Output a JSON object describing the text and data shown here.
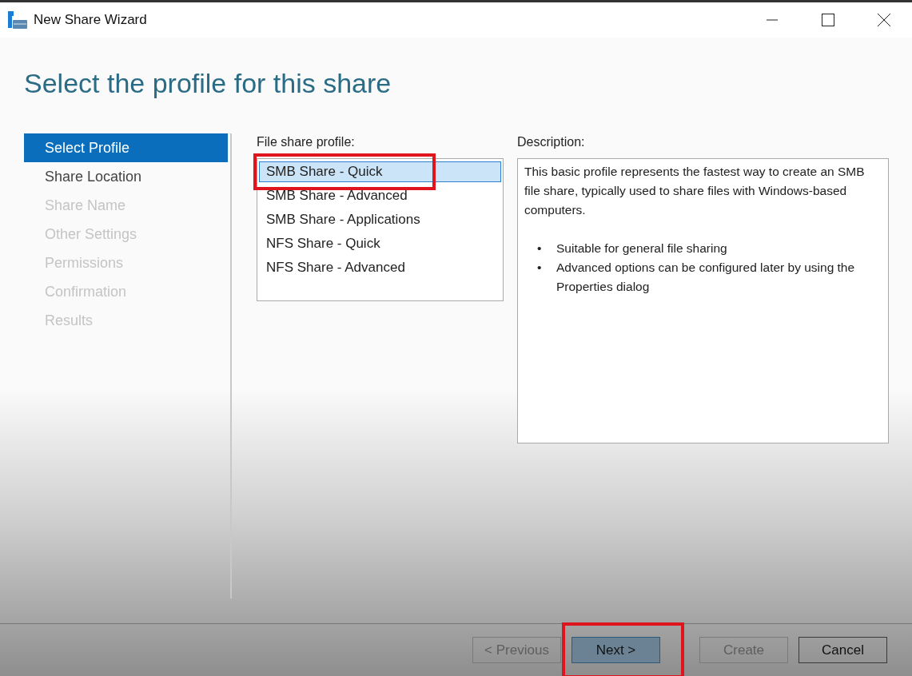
{
  "window": {
    "title": "New Share Wizard"
  },
  "heading": "Select the profile for this share",
  "steps": [
    {
      "label": "Select Profile",
      "selected": true,
      "disabled": false
    },
    {
      "label": "Share Location",
      "selected": false,
      "disabled": false
    },
    {
      "label": "Share Name",
      "selected": false,
      "disabled": true
    },
    {
      "label": "Other Settings",
      "selected": false,
      "disabled": true
    },
    {
      "label": "Permissions",
      "selected": false,
      "disabled": true
    },
    {
      "label": "Confirmation",
      "selected": false,
      "disabled": true
    },
    {
      "label": "Results",
      "selected": false,
      "disabled": true
    }
  ],
  "profiles": {
    "label": "File share profile:",
    "items": [
      {
        "label": "SMB Share - Quick",
        "selected": true,
        "highlighted": true
      },
      {
        "label": "SMB Share - Advanced",
        "selected": false,
        "highlighted": false
      },
      {
        "label": "SMB Share - Applications",
        "selected": false,
        "highlighted": false
      },
      {
        "label": "NFS Share - Quick",
        "selected": false,
        "highlighted": false
      },
      {
        "label": "NFS Share - Advanced",
        "selected": false,
        "highlighted": false
      }
    ]
  },
  "description": {
    "label": "Description:",
    "text": "This basic profile represents the fastest way to create an SMB file share, typically used to share files with Windows-based computers.",
    "bullets": [
      {
        "marker": "•",
        "text": "Suitable for general file sharing"
      },
      {
        "marker": "•",
        "text": "Advanced options can be configured later by using the Properties dialog"
      }
    ]
  },
  "buttons": [
    {
      "label": "< Previous",
      "disabled": true,
      "default": false,
      "highlighted": false
    },
    {
      "label": "Next >",
      "disabled": false,
      "default": true,
      "highlighted": true
    },
    {
      "label": "Create",
      "disabled": true,
      "default": false,
      "highlighted": false
    },
    {
      "label": "Cancel",
      "disabled": false,
      "default": false,
      "highlighted": false
    }
  ]
}
